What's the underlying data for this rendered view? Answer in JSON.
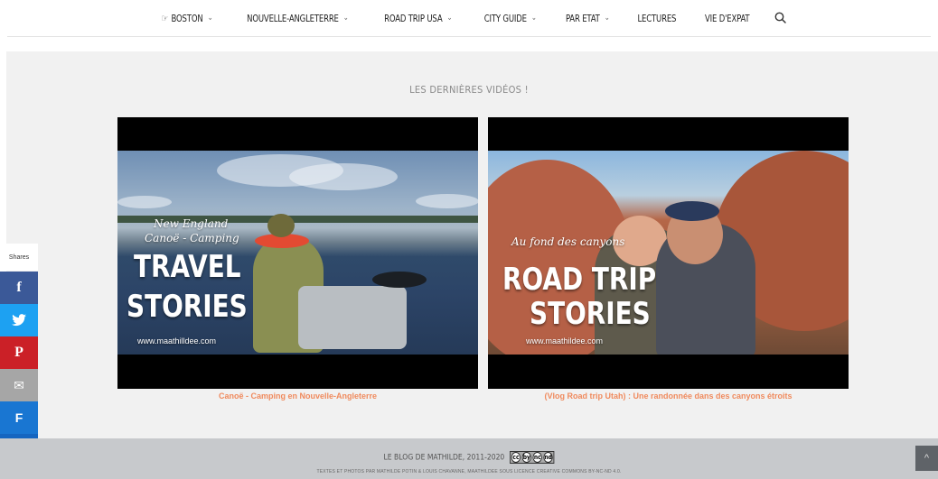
{
  "nav": {
    "items": [
      {
        "label": "BOSTON",
        "prefix": "☞",
        "dropdown": true
      },
      {
        "label": "NOUVELLE-ANGLETERRE",
        "dropdown": true
      },
      {
        "label": "ROAD TRIP USA",
        "dropdown": true
      },
      {
        "label": "CITY GUIDE",
        "dropdown": true
      },
      {
        "label": "PAR ETAT",
        "dropdown": true
      },
      {
        "label": "LECTURES",
        "dropdown": false
      },
      {
        "label": "VIE D'EXPAT",
        "dropdown": false
      }
    ],
    "chevron": "⌄",
    "search_icon": "search-icon"
  },
  "section": {
    "title": "LES DERNIÈRES VIDÉOS !"
  },
  "videos": [
    {
      "script_line1": "New England",
      "script_line2": "Canoë - Camping",
      "big_line1": "TRAVEL",
      "big_line2": "STORIES",
      "url": "www.maathilldee.com",
      "caption": "Canoë - Camping en Nouvelle-Angleterre"
    },
    {
      "script_line1": "Au fond des canyons",
      "script_line2": "",
      "big_line1": "ROAD TRIP",
      "big_line2": "STORIES",
      "url": "www.maathildee.com",
      "caption": "(Vlog Road trip Utah) : Une randonnée dans des canyons étroits"
    }
  ],
  "share": {
    "label": "Shares",
    "buttons": [
      {
        "name": "facebook",
        "glyph": "f"
      },
      {
        "name": "twitter",
        "glyph": "🐦"
      },
      {
        "name": "pinterest",
        "glyph": "P"
      },
      {
        "name": "email",
        "glyph": "✉"
      },
      {
        "name": "flipboard",
        "glyph": "F"
      },
      {
        "name": "sumo",
        "glyph": "♛"
      }
    ]
  },
  "footer": {
    "line1": "LE BLOG DE MATHILDE, 2011-2020",
    "cc_badge": [
      "cc",
      "by",
      "nc",
      "nd"
    ],
    "line2": "TEXTES ET PHOTOS PAR MATHILDE POTIN & LOUIS CHAVANNE, MAATHILDEE SOUS LICENCE CREATIVE COMMONS BY-NC-ND 4.0.",
    "back_to_top": "^"
  },
  "colors": {
    "caption": "#f08a5d",
    "facebook": "#3b5998",
    "twitter": "#1da1f2",
    "pinterest": "#cb2027",
    "email": "#a6a6a6",
    "flipboard": "#1976d2",
    "footer_bg": "#c7c9cc",
    "section_bg": "#f1f1f1"
  }
}
